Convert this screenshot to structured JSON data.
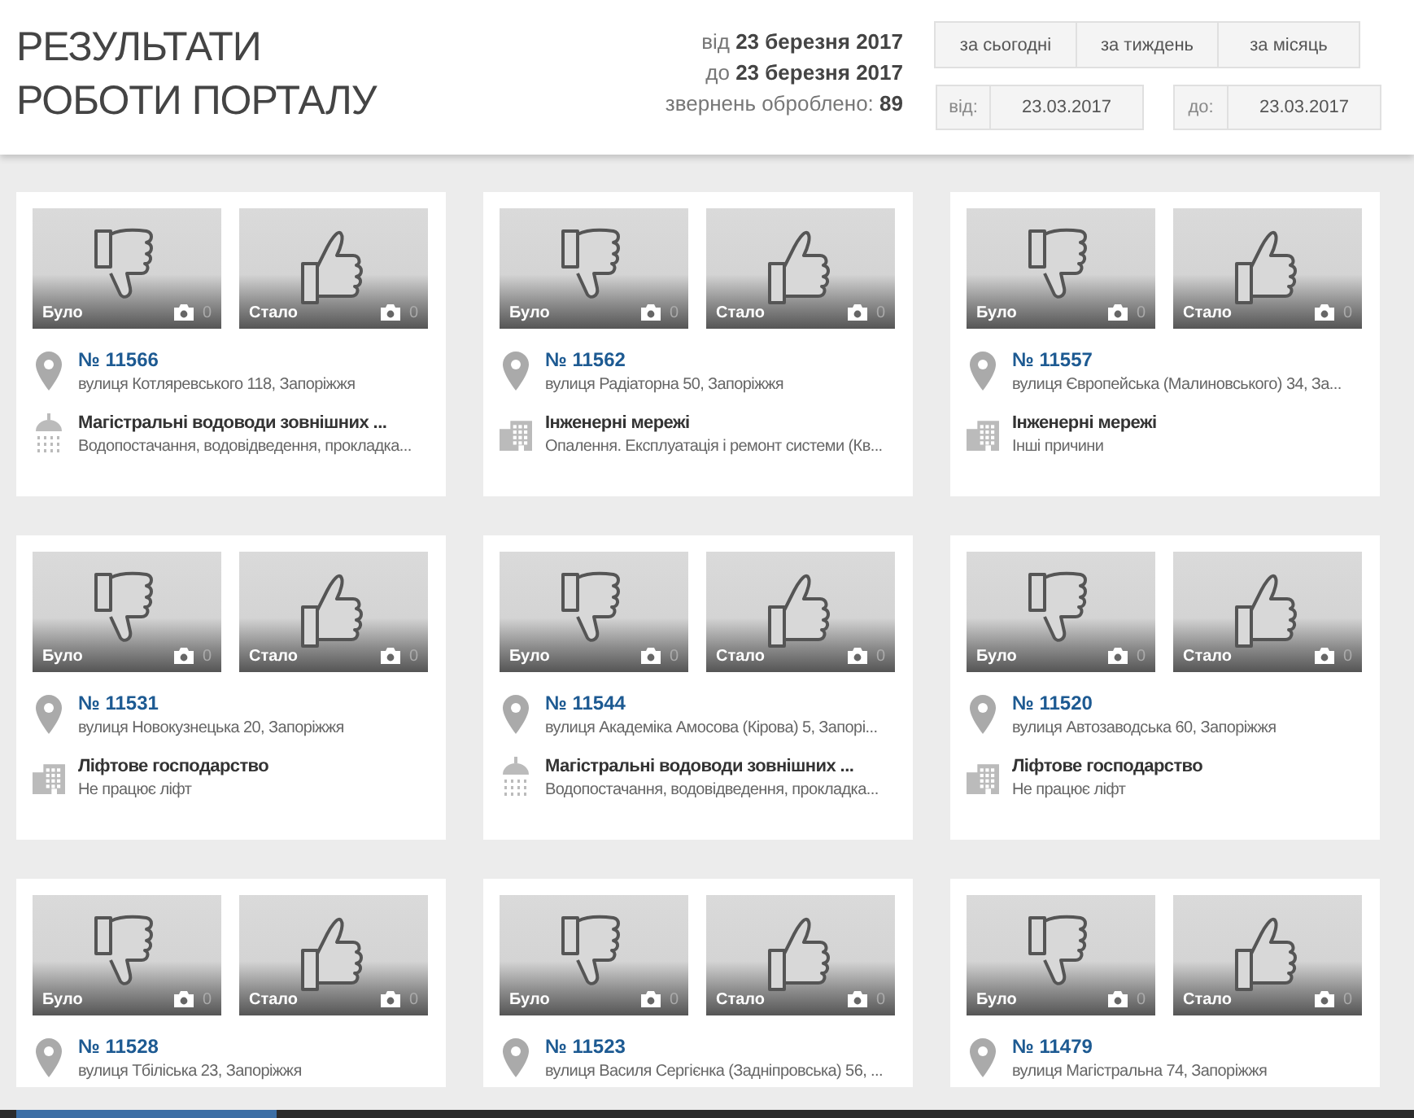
{
  "header": {
    "title_lines": [
      "РЕЗУЛЬТАТИ",
      "РОБОТИ ПОРТАЛУ"
    ],
    "summary": [
      "від **23 березня 2017**",
      "до **23 березня 2017**",
      "звернень оброблено: **89**"
    ],
    "period_buttons": [
      "за сьогодні",
      "за тиждень",
      "за місяць"
    ],
    "date_fields": [
      {
        "label": "від:",
        "value": "23.03.2017"
      },
      {
        "label": "до:",
        "value": "23.03.2017"
      }
    ]
  },
  "cards": [
    {
      "photos": [
        {
          "label": "Було",
          "kind": "before",
          "count": "0"
        },
        {
          "label": "Стало",
          "kind": "after",
          "count": "0"
        }
      ],
      "number": "№ 11566",
      "address": "вулиця Котляревського 118, Запоріжжя",
      "category": {
        "kind": "water",
        "title": "Магістральні водоводи зовнішних ...",
        "subtitle": "Водопостачання, водовідведення, прокладка..."
      }
    },
    {
      "photos": [
        {
          "label": "Було",
          "kind": "before",
          "count": "0"
        },
        {
          "label": "Стало",
          "kind": "after",
          "count": "0"
        }
      ],
      "number": "№ 11562",
      "address": "вулиця Радіаторна 50, Запоріжжя",
      "category": {
        "kind": "building",
        "title": "Інженерні мережі",
        "subtitle": "Опалення. Експлуатація і ремонт системи (Кв..."
      }
    },
    {
      "photos": [
        {
          "label": "Було",
          "kind": "before",
          "count": "0"
        },
        {
          "label": "Стало",
          "kind": "after",
          "count": "0"
        }
      ],
      "number": "№ 11557",
      "address": "вулиця Європейська (Малиновського) 34, За...",
      "category": {
        "kind": "building",
        "title": "Інженерні мережі",
        "subtitle": "Інші причини"
      }
    },
    {
      "photos": [
        {
          "label": "Було",
          "kind": "before",
          "count": "0"
        },
        {
          "label": "Стало",
          "kind": "after",
          "count": "0"
        }
      ],
      "number": "№ 11531",
      "address": "вулиця Новокузнецька 20, Запоріжжя",
      "category": {
        "kind": "building",
        "title": "Ліфтове господарство",
        "subtitle": "Не працює ліфт"
      }
    },
    {
      "photos": [
        {
          "label": "Було",
          "kind": "before",
          "count": "0"
        },
        {
          "label": "Стало",
          "kind": "after",
          "count": "0"
        }
      ],
      "number": "№ 11544",
      "address": "вулиця Академіка Амосова (Кірова) 5, Запорі...",
      "category": {
        "kind": "water",
        "title": "Магістральні водоводи зовнішних ...",
        "subtitle": "Водопостачання, водовідведення, прокладка..."
      }
    },
    {
      "photos": [
        {
          "label": "Було",
          "kind": "before",
          "count": "0"
        },
        {
          "label": "Стало",
          "kind": "after",
          "count": "0"
        }
      ],
      "number": "№ 11520",
      "address": "вулиця Автозаводська 60, Запоріжжя",
      "category": {
        "kind": "building",
        "title": "Ліфтове господарство",
        "subtitle": "Не працює ліфт"
      }
    },
    {
      "photos": [
        {
          "label": "Було",
          "kind": "before",
          "count": "0"
        },
        {
          "label": "Стало",
          "kind": "after",
          "count": "0"
        }
      ],
      "number": "№ 11528",
      "address": "вулиця Тбіліська 23, Запоріжжя"
    },
    {
      "photos": [
        {
          "label": "Було",
          "kind": "before",
          "count": "0"
        },
        {
          "label": "Стало",
          "kind": "after",
          "count": "0"
        }
      ],
      "number": "№ 11523",
      "address": "вулиця Василя Сергієнка (Задніпровська) 56, ..."
    },
    {
      "photos": [
        {
          "label": "Було",
          "kind": "before",
          "count": "0"
        },
        {
          "label": "Стало",
          "kind": "after",
          "count": "0"
        }
      ],
      "number": "№ 11479",
      "address": "вулиця Магістральна 74, Запоріжжя"
    }
  ]
}
